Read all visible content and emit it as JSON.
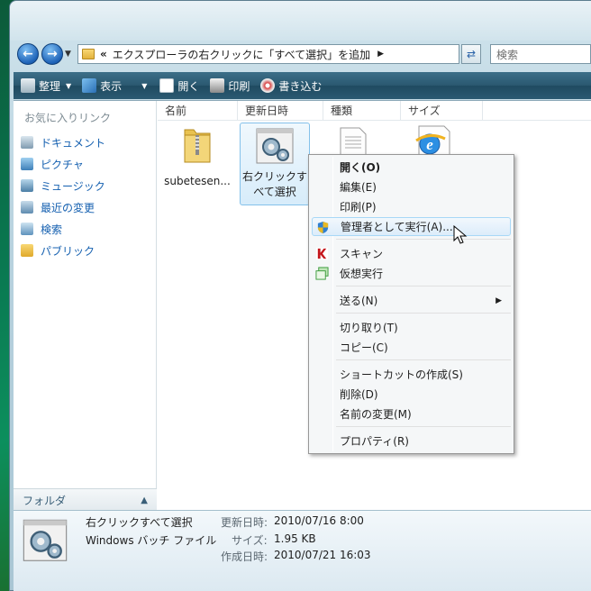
{
  "address": {
    "breadcrumb_prefix": "«",
    "path": "エクスプローラの右クリックに「すべて選択」を追加",
    "search_placeholder": "検索"
  },
  "toolbar": {
    "organize": "整理",
    "view": "表示",
    "open": "開く",
    "print": "印刷",
    "burn": "書き込む"
  },
  "nav": {
    "favorites_header": "お気に入りリンク",
    "items": [
      "ドキュメント",
      "ピクチャ",
      "ミュージック",
      "最近の変更",
      "検索",
      "パブリック"
    ],
    "folders_label": "フォルダ"
  },
  "columns": [
    "名前",
    "更新日時",
    "種類",
    "サイズ"
  ],
  "files": {
    "zip_label": "subetesen...",
    "bat_label_line1": "右クリックす",
    "bat_label_line2": "べて選択"
  },
  "context_menu": {
    "open": "開く(O)",
    "edit": "編集(E)",
    "print": "印刷(P)",
    "run_as_admin": "管理者として実行(A)...",
    "scan": "スキャン",
    "virtual_run": "仮想実行",
    "send_to": "送る(N)",
    "cut": "切り取り(T)",
    "copy": "コピー(C)",
    "create_shortcut": "ショートカットの作成(S)",
    "delete": "削除(D)",
    "rename": "名前の変更(M)",
    "properties": "プロパティ(R)"
  },
  "details": {
    "name": "右クリックすべて選択",
    "type": "Windows バッチ ファイル",
    "modified_key": "更新日時:",
    "modified_val": "2010/07/16 8:00",
    "size_key": "サイズ:",
    "size_val": "1.95 KB",
    "created_key": "作成日時:",
    "created_val": "2010/07/21 16:03"
  }
}
